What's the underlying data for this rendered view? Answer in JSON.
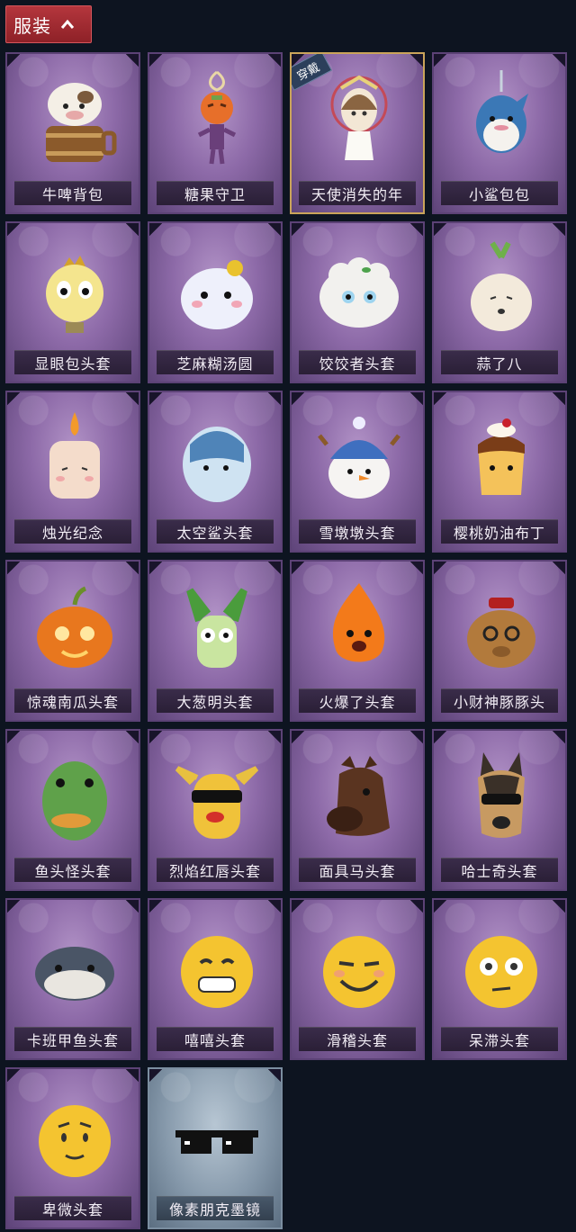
{
  "header": {
    "label": "服装",
    "chevron_icon": "chevron-up-icon"
  },
  "items": [
    {
      "label": "牛啤背包",
      "icon": "cow-beer-backpack-icon"
    },
    {
      "label": "糖果守卫",
      "icon": "candy-guard-charm-icon"
    },
    {
      "label": "天使消失的年",
      "icon": "angel-doll-charm-icon",
      "badge": "穿戴",
      "selected": true
    },
    {
      "label": "小鲨包包",
      "icon": "shark-bag-charm-icon"
    },
    {
      "label": "显眼包头套",
      "icon": "lightbulb-head-icon"
    },
    {
      "label": "芝麻糊汤圆",
      "icon": "rice-ball-head-icon"
    },
    {
      "label": "饺饺者头套",
      "icon": "dumpling-head-icon"
    },
    {
      "label": "蒜了八",
      "icon": "garlic-head-icon"
    },
    {
      "label": "烛光纪念",
      "icon": "candle-head-icon"
    },
    {
      "label": "太空鲨头套",
      "icon": "space-shark-head-icon"
    },
    {
      "label": "雪墩墩头套",
      "icon": "snowman-head-icon"
    },
    {
      "label": "樱桃奶油布丁",
      "icon": "pudding-head-icon"
    },
    {
      "label": "惊魂南瓜头套",
      "icon": "pumpkin-head-icon"
    },
    {
      "label": "大葱明头套",
      "icon": "scallion-head-icon"
    },
    {
      "label": "火爆了头套",
      "icon": "fire-head-icon"
    },
    {
      "label": "小财神豚豚头",
      "icon": "capybara-head-icon"
    },
    {
      "label": "鱼头怪头套",
      "icon": "fish-head-icon"
    },
    {
      "label": "烈焰红唇头套",
      "icon": "red-lips-head-icon"
    },
    {
      "label": "面具马头套",
      "icon": "horse-head-icon"
    },
    {
      "label": "哈士奇头套",
      "icon": "husky-head-icon"
    },
    {
      "label": "卡班甲鱼头套",
      "icon": "armored-fish-head-icon"
    },
    {
      "label": "嘻嘻头套",
      "icon": "grin-emoji-head-icon"
    },
    {
      "label": "滑稽头套",
      "icon": "funny-emoji-head-icon"
    },
    {
      "label": "呆滞头套",
      "icon": "dazed-emoji-head-icon"
    },
    {
      "label": "卑微头套",
      "icon": "humble-emoji-head-icon"
    },
    {
      "label": "像素朋克墨镜",
      "icon": "pixel-sunglasses-icon",
      "plain": true
    }
  ]
}
